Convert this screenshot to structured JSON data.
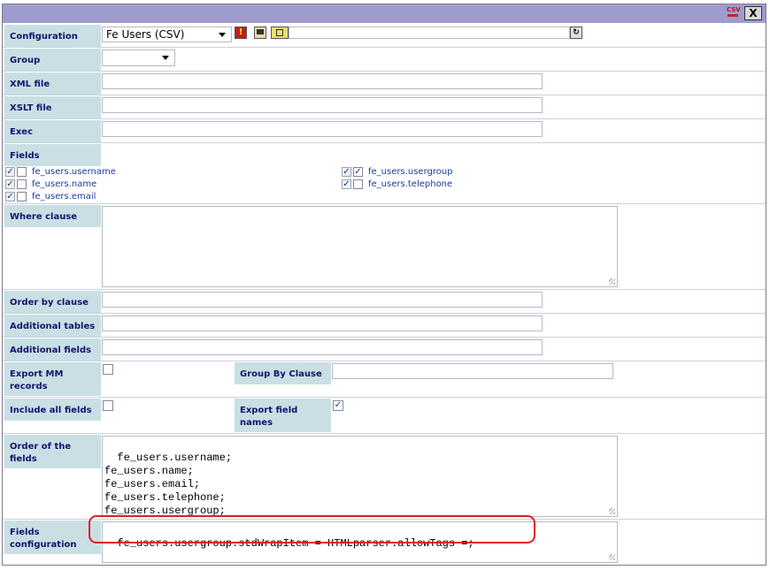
{
  "toolbar": {
    "csv_icon": "CSV",
    "close_icon": "X"
  },
  "configuration": {
    "label": "Configuration",
    "selected": "Fe Users (CSV)"
  },
  "group": {
    "label": "Group",
    "selected": ""
  },
  "xml_file": {
    "label": "XML file",
    "value": ""
  },
  "xslt_file": {
    "label": "XSLT file",
    "value": ""
  },
  "exec": {
    "label": "Exec",
    "value": ""
  },
  "fields": {
    "label": "Fields",
    "items": [
      {
        "name": "fe_users.username",
        "checked1": true,
        "checked2": false
      },
      {
        "name": "fe_users.name",
        "checked1": true,
        "checked2": false
      },
      {
        "name": "fe_users.email",
        "checked1": true,
        "checked2": false
      },
      {
        "name": "fe_users.usergroup",
        "checked1": true,
        "checked2": true
      },
      {
        "name": "fe_users.telephone",
        "checked1": true,
        "checked2": false
      }
    ]
  },
  "where_clause": {
    "label": "Where clause",
    "value": ""
  },
  "order_by_clause": {
    "label": "Order by clause",
    "value": ""
  },
  "additional_tables": {
    "label": "Additional tables",
    "value": ""
  },
  "additional_fields": {
    "label": "Additional fields",
    "value": ""
  },
  "export_mm_records": {
    "label_line1": "Export MM",
    "label_line2": "records",
    "checked": false
  },
  "group_by_clause": {
    "label": "Group By Clause",
    "value": ""
  },
  "include_all_fields": {
    "label": "Include all fields",
    "checked": false
  },
  "export_field_names": {
    "label_line1": "Export field",
    "label_line2": "names",
    "checked": true
  },
  "order_of_fields": {
    "label_line1": "Order of the",
    "label_line2": "fields",
    "value": "fe_users.username;\nfe_users.name;\nfe_users.email;\nfe_users.telephone;\nfe_users.usergroup;"
  },
  "fields_configuration": {
    "label_line1": "Fields",
    "label_line2": "configuration",
    "value": "fe_users.usergroup.stdWrapItem = HTMLparser.allowTags =;"
  },
  "colors": {
    "titlebar": "#9e9cce",
    "label_bg": "#c9dfe4",
    "label_text": "#13136e",
    "highlight": "#e02020"
  }
}
